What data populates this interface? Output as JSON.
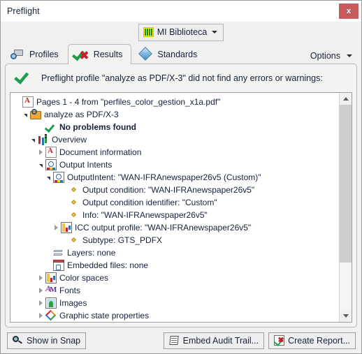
{
  "window": {
    "title": "Preflight",
    "close_label": "x"
  },
  "library": {
    "label": "MI Biblioteca",
    "icon": "bar-chart-icon",
    "caret": "chevron-down-icon"
  },
  "tabs": [
    {
      "label": "Profiles",
      "icon": "printer-search-icon",
      "active": false
    },
    {
      "label": "Results",
      "icon": "check-cross-icon",
      "active": true
    },
    {
      "label": "Standards",
      "icon": "diamond-icon",
      "active": false
    }
  ],
  "options": {
    "label": "Options",
    "caret": "chevron-down-icon"
  },
  "summary": {
    "icon": "green-check-icon",
    "text": "Preflight profile \"analyze as PDF/X-3\" did not find any errors or warnings:"
  },
  "tree": [
    {
      "label": "Pages 1 - 4 from \"perfiles_color_gestion_x1a.pdf\"",
      "indent": 0,
      "twisty": "none",
      "icon": "pdf-document-icon",
      "bold": false
    },
    {
      "label": "analyze as PDF/X-3",
      "indent": 1,
      "twisty": "open",
      "icon": "profile-icon",
      "bold": false
    },
    {
      "label": "No problems found",
      "indent": 3,
      "twisty": "none",
      "icon": "green-check-icon",
      "bold": true
    },
    {
      "label": "Overview",
      "indent": 2,
      "twisty": "open",
      "icon": "overview-bars-icon",
      "bold": false
    },
    {
      "label": "Document information",
      "indent": 3,
      "twisty": "closed",
      "icon": "pdf-document-icon",
      "bold": false
    },
    {
      "label": "Output Intents",
      "indent": 3,
      "twisty": "open",
      "icon": "output-intent-icon",
      "bold": false
    },
    {
      "label": "OutputIntent: \"WAN-IFRAnewspaper26v5 (Custom)\"",
      "indent": 4,
      "twisty": "open",
      "icon": "output-intent-icon",
      "bold": false
    },
    {
      "label": "Output condition: \"WAN-IFRAnewspaper26v5\"",
      "indent": 6,
      "twisty": "none",
      "icon": "bullet-diamond-icon",
      "bold": false
    },
    {
      "label": "Output condition identifier: \"Custom\"",
      "indent": 6,
      "twisty": "none",
      "icon": "bullet-diamond-icon",
      "bold": false
    },
    {
      "label": "Info: \"WAN-IFRAnewspaper26v5\"",
      "indent": 6,
      "twisty": "none",
      "icon": "bullet-diamond-icon",
      "bold": false
    },
    {
      "label": "ICC output profile: \"WAN-IFRAnewspaper26v5\"",
      "indent": 5,
      "twisty": "closed",
      "icon": "icc-profile-icon",
      "bold": false
    },
    {
      "label": "Subtype: GTS_PDFX",
      "indent": 6,
      "twisty": "none",
      "icon": "bullet-diamond-icon",
      "bold": false
    },
    {
      "label": "Layers: none",
      "indent": 4,
      "twisty": "none",
      "icon": "layers-icon",
      "bold": false
    },
    {
      "label": "Embedded files: none",
      "indent": 4,
      "twisty": "none",
      "icon": "embedded-files-icon",
      "bold": false
    },
    {
      "label": "Color spaces",
      "indent": 3,
      "twisty": "closed",
      "icon": "color-spaces-icon",
      "bold": false
    },
    {
      "label": "Fonts",
      "indent": 3,
      "twisty": "closed",
      "icon": "fonts-icon",
      "bold": false
    },
    {
      "label": "Images",
      "indent": 3,
      "twisty": "closed",
      "icon": "images-icon",
      "bold": false
    },
    {
      "label": "Graphic state properties",
      "indent": 3,
      "twisty": "closed",
      "icon": "graphic-state-icon",
      "bold": false
    }
  ],
  "scrollbar": {
    "up_arrow": "chevron-up-icon",
    "down_arrow": "chevron-down-icon",
    "thumb_fraction": 0.77
  },
  "footer": {
    "show_in_snap": "Show in Snap",
    "embed_audit_trail": "Embed Audit Trail...",
    "create_report": "Create Report..."
  },
  "colors": {
    "accent_green": "#1a9e4b",
    "accent_red": "#c4202a",
    "close_red": "#c75a5a",
    "window_bg": "#f0f0f0",
    "panel_bg": "#f3f3f1",
    "tree_bg": "#ffffff"
  }
}
